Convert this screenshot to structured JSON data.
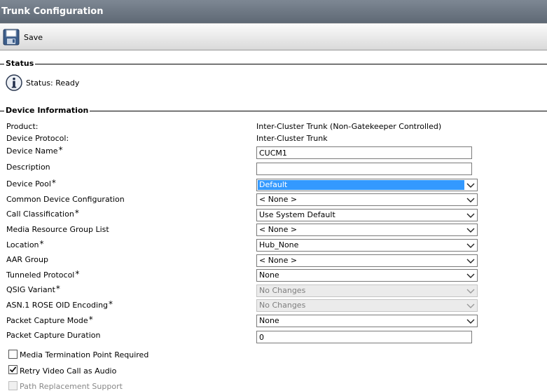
{
  "header": {
    "title": "Trunk Configuration"
  },
  "toolbar": {
    "save_label": "Save",
    "save_icon": "floppy-disk-icon"
  },
  "status": {
    "section_title": "Status",
    "text": "Status: Ready",
    "icon": "info-icon"
  },
  "device": {
    "section_title": "Device Information",
    "product_label": "Product:",
    "product_value": "Inter-Cluster Trunk (Non-Gatekeeper Controlled)",
    "protocol_label": "Device Protocol:",
    "protocol_value": "Inter-Cluster Trunk",
    "device_name_label": "Device Name",
    "device_name_value": "CUCM1",
    "description_label": "Description",
    "description_value": "",
    "device_pool_label": "Device Pool",
    "device_pool_value": "Default",
    "common_device_config_label": "Common Device Configuration",
    "common_device_config_value": "< None >",
    "call_classification_label": "Call Classification",
    "call_classification_value": "Use System Default",
    "mrgl_label": "Media Resource Group List",
    "mrgl_value": "< None >",
    "location_label": "Location",
    "location_value": "Hub_None",
    "aar_group_label": "AAR Group",
    "aar_group_value": "< None >",
    "tunneled_protocol_label": "Tunneled Protocol",
    "tunneled_protocol_value": "None",
    "qsig_variant_label": "QSIG Variant",
    "qsig_variant_value": "No Changes",
    "asn_rose_label": "ASN.1 ROSE OID Encoding",
    "asn_rose_value": "No Changes",
    "packet_capture_mode_label": "Packet Capture Mode",
    "packet_capture_mode_value": "None",
    "packet_capture_duration_label": "Packet Capture Duration",
    "packet_capture_duration_value": "0",
    "required_marker": "*"
  },
  "checkboxes": [
    {
      "label": "Media Termination Point Required",
      "checked": false,
      "disabled": false
    },
    {
      "label": "Retry Video Call as Audio",
      "checked": true,
      "disabled": false
    },
    {
      "label": "Path Replacement Support",
      "checked": false,
      "disabled": true
    }
  ],
  "colors": {
    "title_bar": "#6b7582",
    "selection_highlight": "#3399ff",
    "toolbar_bg": "#e6e6e6"
  }
}
